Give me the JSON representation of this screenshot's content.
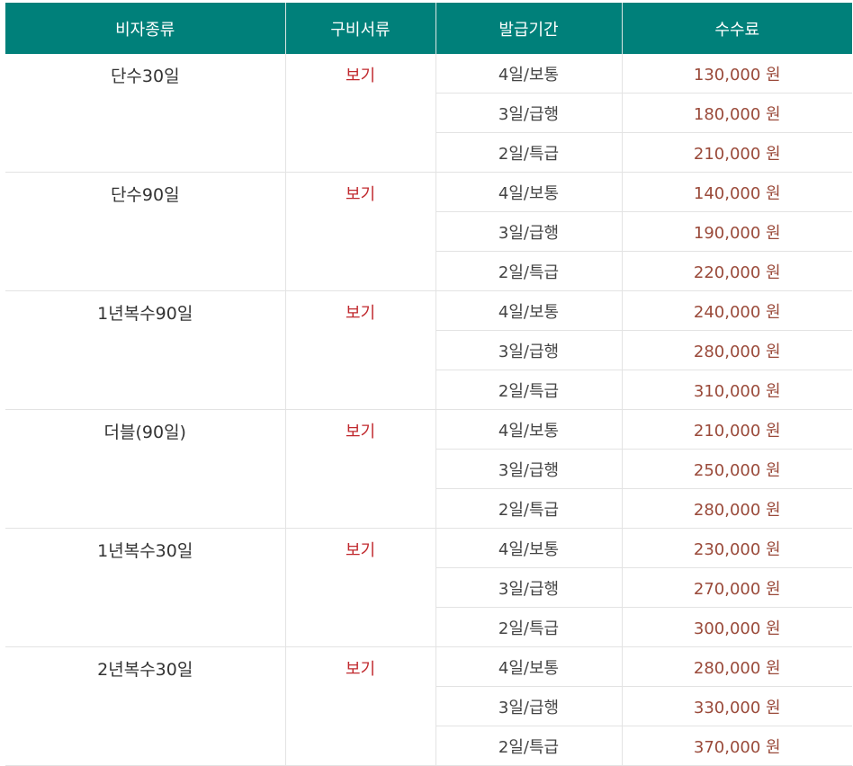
{
  "header": {
    "type": "비자종류",
    "docs": "구비서류",
    "period": "발급기간",
    "fee": "수수료"
  },
  "docs_link_label": "보기",
  "visas": [
    {
      "name": "단수30일",
      "options": [
        {
          "period": "4일/보통",
          "fee": "130,000 원"
        },
        {
          "period": "3일/급행",
          "fee": "180,000 원"
        },
        {
          "period": "2일/특급",
          "fee": "210,000 원"
        }
      ]
    },
    {
      "name": "단수90일",
      "options": [
        {
          "period": "4일/보통",
          "fee": "140,000 원"
        },
        {
          "period": "3일/급행",
          "fee": "190,000 원"
        },
        {
          "period": "2일/특급",
          "fee": "220,000 원"
        }
      ]
    },
    {
      "name": "1년복수90일",
      "options": [
        {
          "period": "4일/보통",
          "fee": "240,000 원"
        },
        {
          "period": "3일/급행",
          "fee": "280,000 원"
        },
        {
          "period": "2일/특급",
          "fee": "310,000 원"
        }
      ]
    },
    {
      "name": "더블(90일)",
      "options": [
        {
          "period": "4일/보통",
          "fee": "210,000 원"
        },
        {
          "period": "3일/급행",
          "fee": "250,000 원"
        },
        {
          "period": "2일/특급",
          "fee": "280,000 원"
        }
      ]
    },
    {
      "name": "1년복수30일",
      "options": [
        {
          "period": "4일/보통",
          "fee": "230,000 원"
        },
        {
          "period": "3일/급행",
          "fee": "270,000 원"
        },
        {
          "period": "2일/특급",
          "fee": "300,000 원"
        }
      ]
    },
    {
      "name": "2년복수30일",
      "options": [
        {
          "period": "4일/보통",
          "fee": "280,000 원"
        },
        {
          "period": "3일/급행",
          "fee": "330,000 원"
        },
        {
          "period": "2일/특급",
          "fee": "370,000 원"
        }
      ]
    }
  ],
  "colors": {
    "header_bg": "#00807a",
    "link": "#c0282d",
    "fee_text": "#9a4a3a"
  }
}
